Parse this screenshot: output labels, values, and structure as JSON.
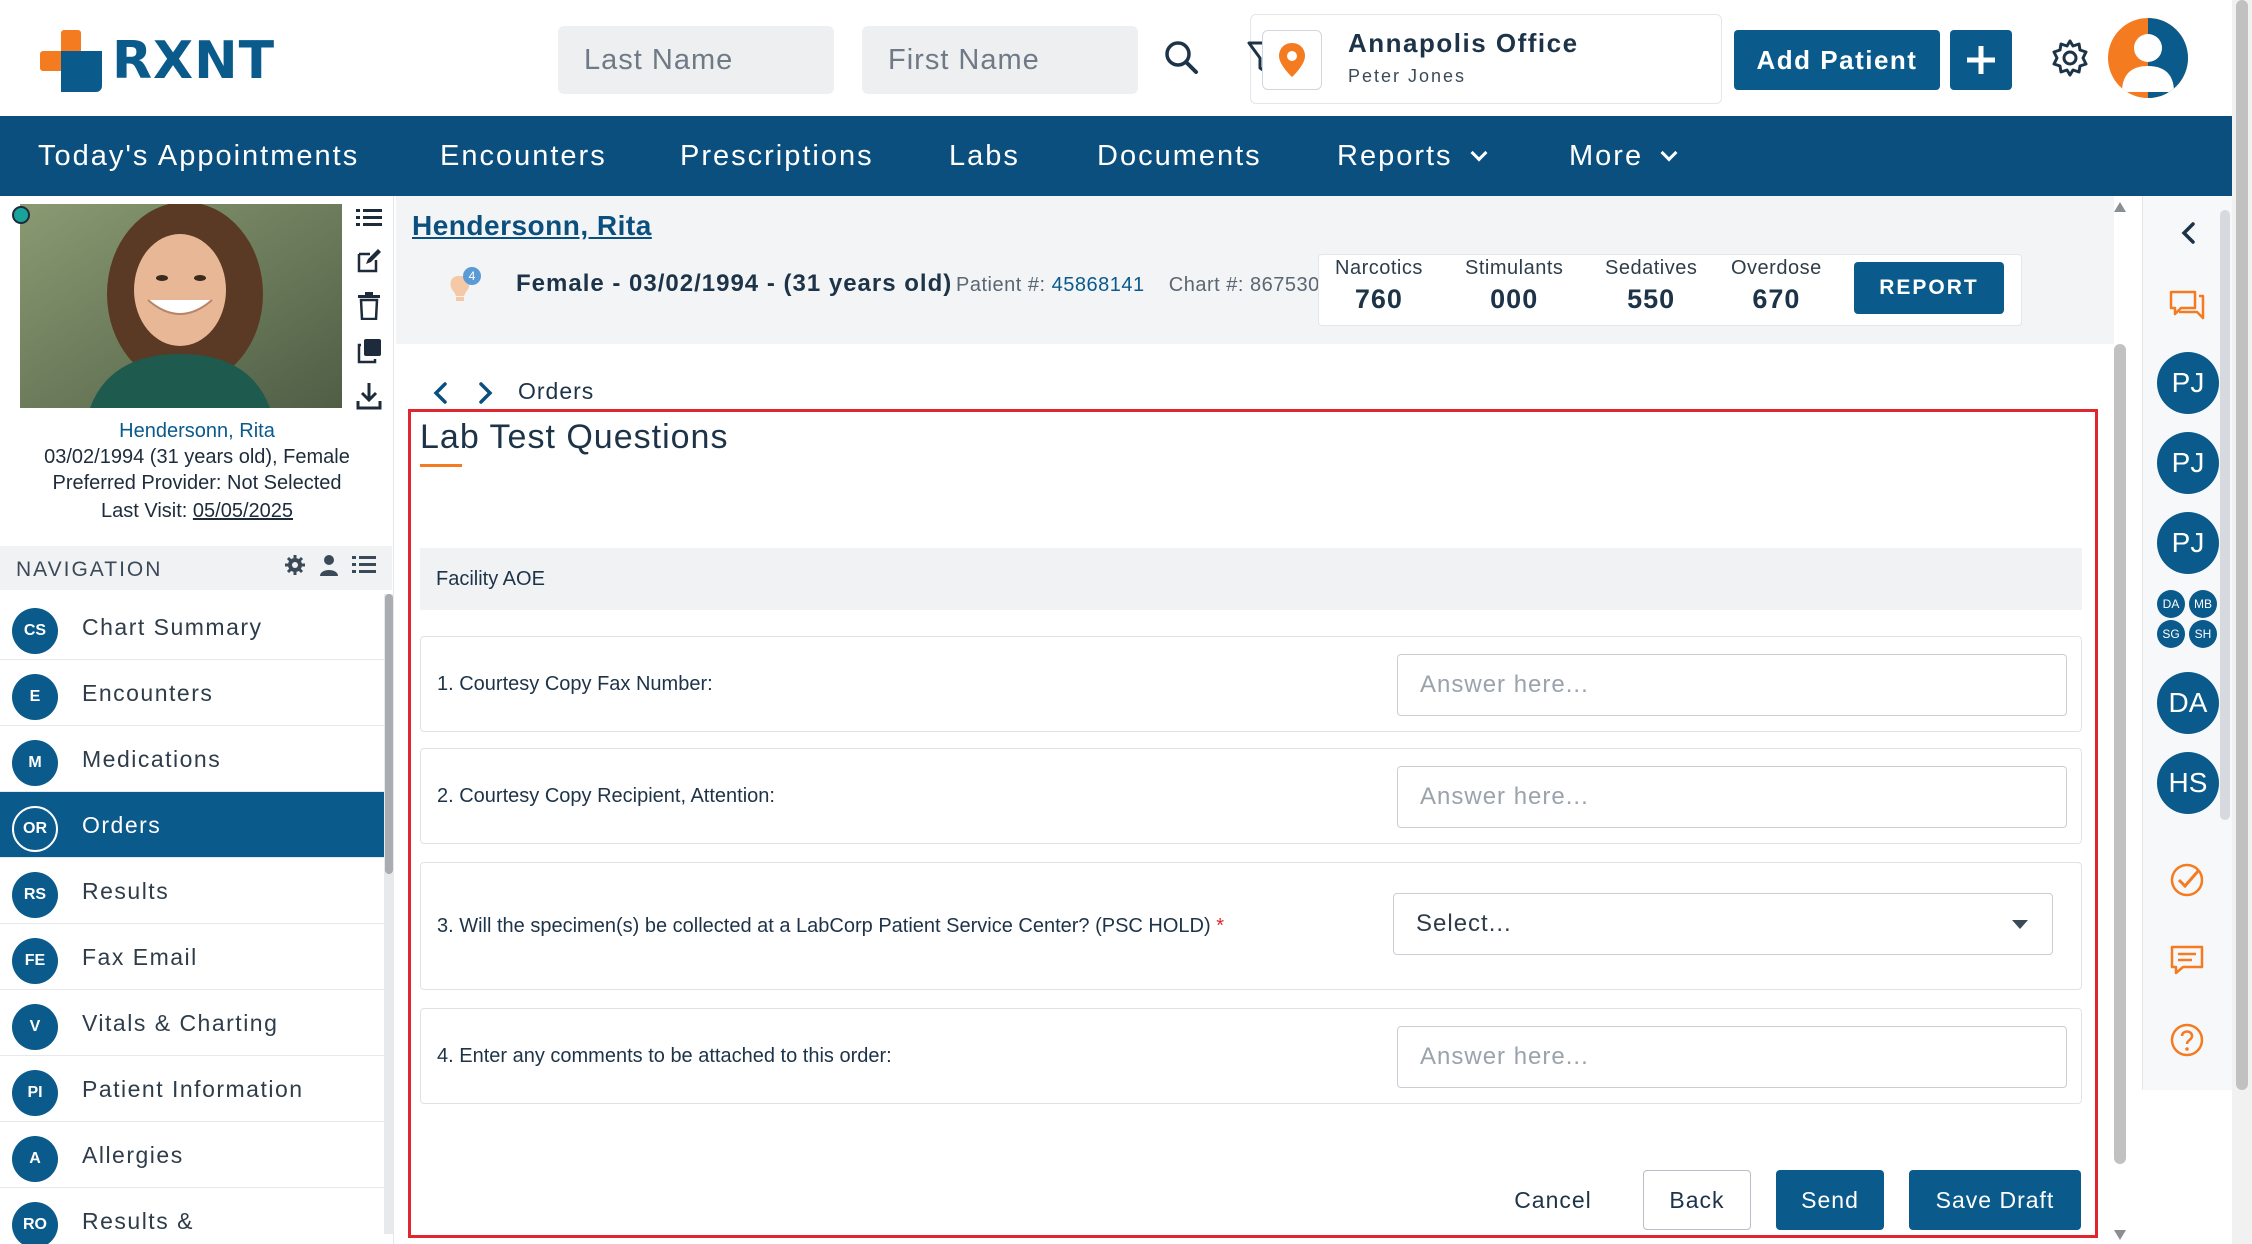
{
  "header": {
    "logo_text": "RXNT",
    "last_name_placeholder": "Last Name",
    "first_name_placeholder": "First Name",
    "office_name": "Annapolis Office",
    "office_user": "Peter Jones",
    "add_patient_label": "Add Patient"
  },
  "main_nav": {
    "items": [
      {
        "label": "Today's Appointments"
      },
      {
        "label": "Encounters"
      },
      {
        "label": "Prescriptions"
      },
      {
        "label": "Labs"
      },
      {
        "label": "Documents"
      },
      {
        "label": "Reports",
        "has_dropdown": true
      },
      {
        "label": "More",
        "has_dropdown": true
      }
    ]
  },
  "patient": {
    "name": "Hendersonn, Rita",
    "dob_line": "03/02/1994 (31 years old), Female",
    "preferred_provider": "Preferred Provider: Not Selected",
    "last_visit_label": "Last Visit:",
    "last_visit_date": "05/05/2025",
    "demographics": "Female - 03/02/1994 - (31 years old)",
    "patient_num_label": "Patient #:",
    "patient_num": "45868141",
    "chart_num_label": "Chart #:",
    "chart_num": "867530",
    "alert_count": "4"
  },
  "counts": [
    {
      "label": "Narcotics",
      "value": "760"
    },
    {
      "label": "Stimulants",
      "value": "000"
    },
    {
      "label": "Sedatives",
      "value": "550"
    },
    {
      "label": "Overdose",
      "value": "670"
    }
  ],
  "report_label": "REPORT",
  "left_nav": {
    "heading": "NAVIGATION",
    "items": [
      {
        "badge": "CS",
        "label": "Chart Summary"
      },
      {
        "badge": "E",
        "label": "Encounters"
      },
      {
        "badge": "M",
        "label": "Medications"
      },
      {
        "badge": "OR",
        "label": "Orders",
        "active": true
      },
      {
        "badge": "RS",
        "label": "Results"
      },
      {
        "badge": "FE",
        "label": "Fax Email"
      },
      {
        "badge": "V",
        "label": "Vitals & Charting"
      },
      {
        "badge": "PI",
        "label": "Patient Information"
      },
      {
        "badge": "A",
        "label": "Allergies"
      },
      {
        "badge": "RO",
        "label": "Results &"
      }
    ]
  },
  "breadcrumb": {
    "label": "Orders"
  },
  "form": {
    "title": "Lab Test Questions",
    "section": "Facility AOE",
    "questions": [
      {
        "text": "1. Courtesy Copy Fax Number:",
        "placeholder": "Answer here..."
      },
      {
        "text": "2. Courtesy Copy Recipient, Attention:",
        "placeholder": "Answer here..."
      },
      {
        "text": "3. Will the specimen(s) be collected at a LabCorp Patient Service Center? (PSC HOLD)",
        "required_mark": "*",
        "select_value": "Select..."
      },
      {
        "text": "4. Enter any comments to be attached to this order:",
        "placeholder": "Answer here..."
      }
    ],
    "cancel_label": "Cancel",
    "back_label": "Back",
    "send_label": "Send",
    "save_draft_label": "Save Draft"
  },
  "right_rail": {
    "avatars": [
      "PJ",
      "PJ",
      "PJ"
    ],
    "mini_avatars": [
      "DA",
      "MB",
      "SG",
      "SH"
    ],
    "large_avatars": [
      "DA",
      "HS"
    ]
  },
  "colors": {
    "brand_blue": "#0a5a8c",
    "nav_blue": "#0a4f7d",
    "brand_orange": "#f47b20",
    "highlight_red": "#e0262f"
  }
}
